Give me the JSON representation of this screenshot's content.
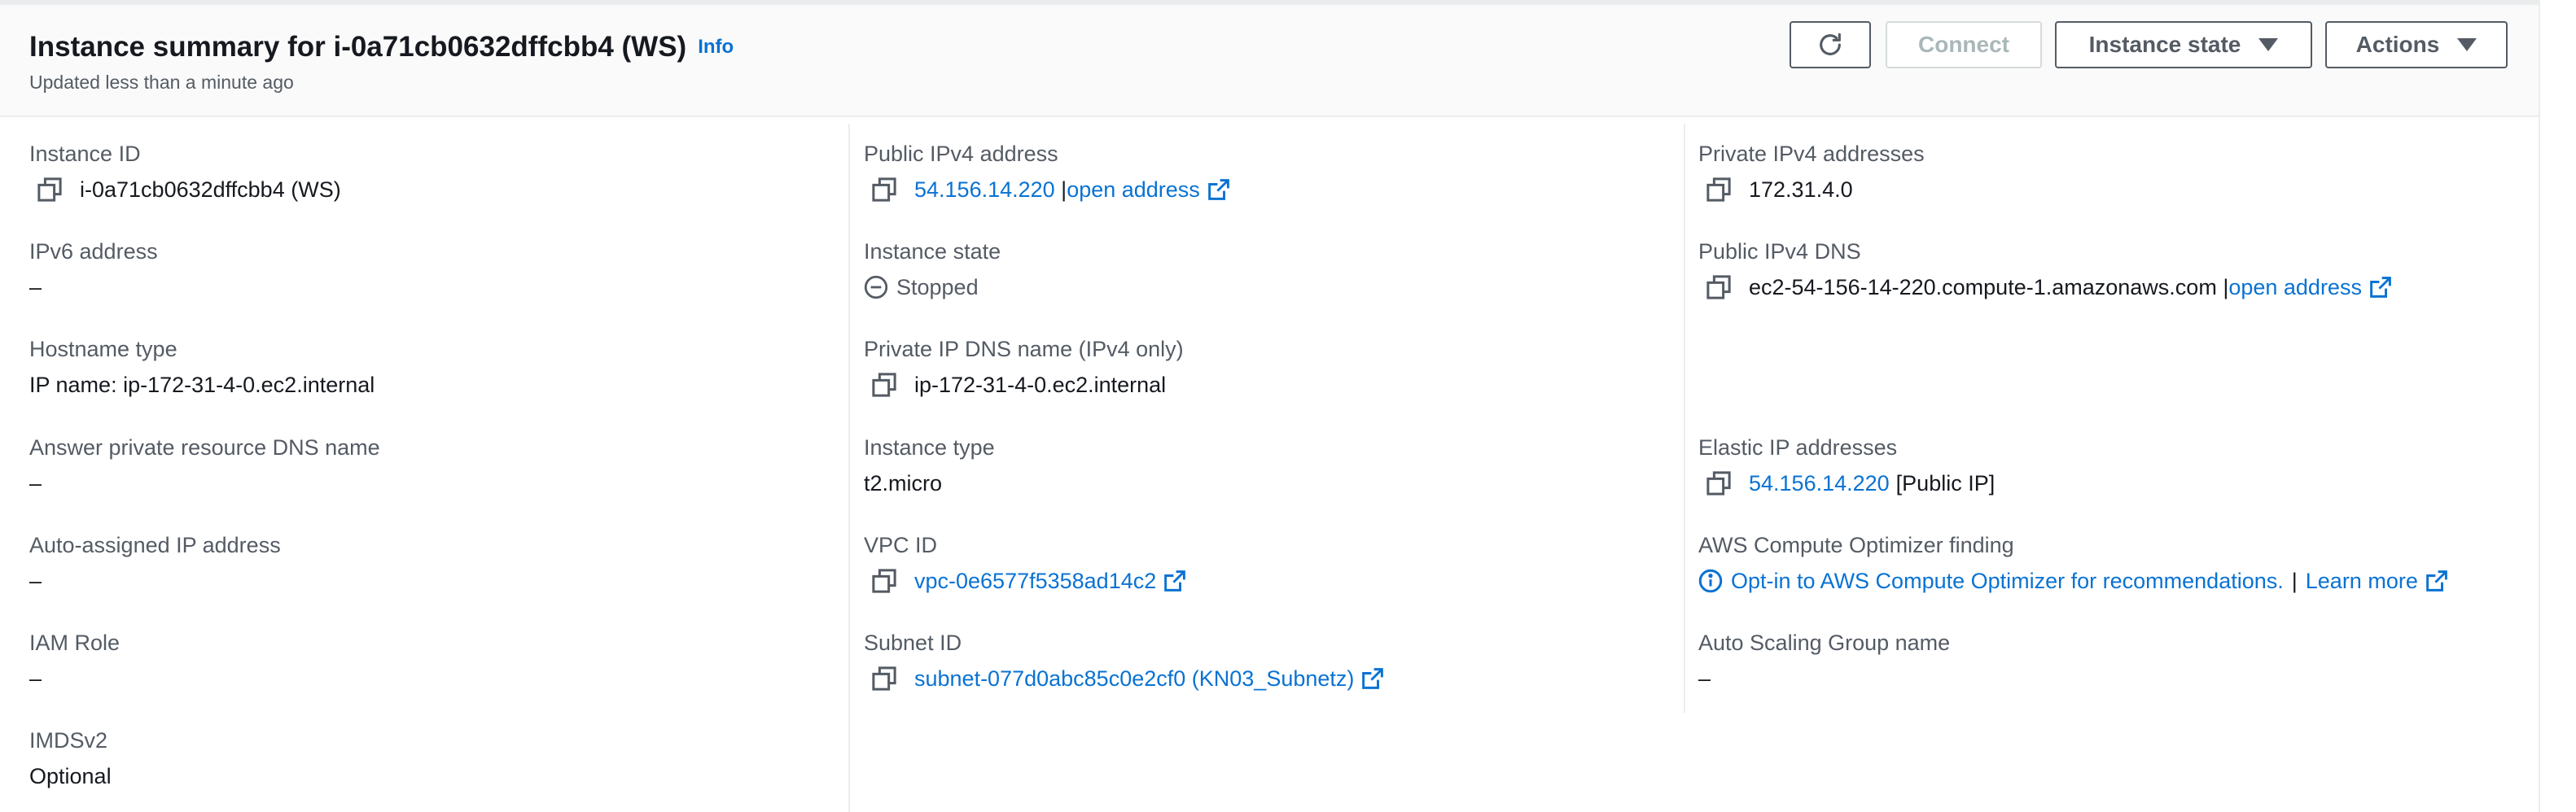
{
  "header": {
    "title": "Instance summary for i-0a71cb0632dffcbb4 (WS)",
    "info_label": "Info",
    "subtitle": "Updated less than a minute ago",
    "refresh_icon": "refresh-icon",
    "connect_label": "Connect",
    "instance_state_label": "Instance state",
    "actions_label": "Actions"
  },
  "col1": {
    "instance_id_label": "Instance ID",
    "instance_id_value": "i-0a71cb0632dffcbb4 (WS)",
    "ipv6_label": "IPv6 address",
    "ipv6_value": "–",
    "hostname_type_label": "Hostname type",
    "hostname_type_value": "IP name: ip-172-31-4-0.ec2.internal",
    "answer_dns_label": "Answer private resource DNS name",
    "answer_dns_value": "–",
    "auto_ip_label": "Auto-assigned IP address",
    "auto_ip_value": "–",
    "iam_role_label": "IAM Role",
    "iam_role_value": "–",
    "imdsv2_label": "IMDSv2",
    "imdsv2_value": "Optional"
  },
  "col2": {
    "public_ipv4_label": "Public IPv4 address",
    "public_ipv4_value": "54.156.14.220",
    "open_address_label": "open address",
    "instance_state_label": "Instance state",
    "instance_state_value": "Stopped",
    "private_dns_label": "Private IP DNS name (IPv4 only)",
    "private_dns_value": "ip-172-31-4-0.ec2.internal",
    "instance_type_label": "Instance type",
    "instance_type_value": "t2.micro",
    "vpc_label": "VPC ID",
    "vpc_value": "vpc-0e6577f5358ad14c2",
    "subnet_label": "Subnet ID",
    "subnet_value": "subnet-077d0abc85c0e2cf0 (KN03_Subnetz)"
  },
  "col3": {
    "private_ipv4_label": "Private IPv4 addresses",
    "private_ipv4_value": "172.31.4.0",
    "public_dns_label": "Public IPv4 DNS",
    "public_dns_value": "ec2-54-156-14-220.compute-1.amazonaws.com",
    "open_address_label": "open address",
    "elastic_ip_label": "Elastic IP addresses",
    "elastic_ip_value": "54.156.14.220",
    "elastic_ip_suffix": "[Public IP]",
    "optimizer_label": "AWS Compute Optimizer finding",
    "optimizer_link": "Opt-in to AWS Compute Optimizer for recommendations.",
    "learn_more_label": "Learn more",
    "asg_label": "Auto Scaling Group name",
    "asg_value": "–"
  },
  "colors": {
    "link": "#0972d3",
    "label": "#545b64",
    "text": "#16191f"
  }
}
